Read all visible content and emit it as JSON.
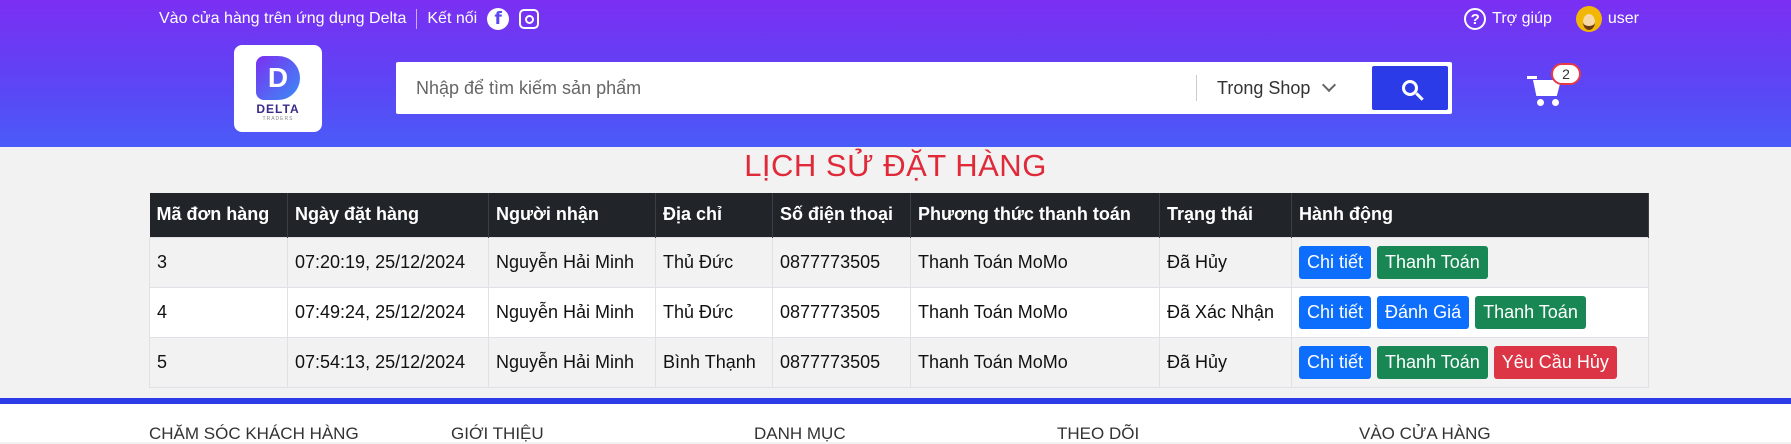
{
  "topbar": {
    "store_app_text": "Vào cửa hàng trên ứng dụng Delta",
    "connect_text": "Kết nối",
    "help_text": "Trợ giúp",
    "user_text": "user"
  },
  "logo": {
    "name": "DELTA",
    "sub": "TRADERS"
  },
  "search": {
    "placeholder": "Nhập để tìm kiếm sản phẩm",
    "scope": "Trong Shop"
  },
  "cart": {
    "count": "2"
  },
  "page_title": "LỊCH SỬ ĐẶT HÀNG",
  "table": {
    "headers": [
      "Mã đơn hàng",
      "Ngày đặt hàng",
      "Người nhận",
      "Địa chỉ",
      "Số điện thoại",
      "Phương thức thanh toán",
      "Trạng thái",
      "Hành động"
    ],
    "rows": [
      {
        "id": "3",
        "date": "07:20:19, 25/12/2024",
        "recipient": "Nguyễn Hải Minh",
        "address": "Thủ Đức",
        "phone": "0877773505",
        "payment": "Thanh Toán MoMo",
        "status": "Đã Hủy",
        "actions": [
          "Chi tiết",
          "Thanh Toán"
        ]
      },
      {
        "id": "4",
        "date": "07:49:24, 25/12/2024",
        "recipient": "Nguyễn Hải Minh",
        "address": "Thủ Đức",
        "phone": "0877773505",
        "payment": "Thanh Toán MoMo",
        "status": "Đã Xác Nhận",
        "actions": [
          "Chi tiết",
          "Đánh Giá",
          "Thanh Toán"
        ]
      },
      {
        "id": "5",
        "date": "07:54:13, 25/12/2024",
        "recipient": "Nguyễn Hải Minh",
        "address": "Bình Thạnh",
        "phone": "0877773505",
        "payment": "Thanh Toán MoMo",
        "status": "Đã Hủy",
        "actions": [
          "Chi tiết",
          "Thanh Toán",
          "Yêu Cầu Hủy"
        ]
      }
    ]
  },
  "footer": {
    "columns": [
      "CHĂM SÓC KHÁCH HÀNG",
      "GIỚI THIỆU",
      "DANH MỤC",
      "THEO DÕI",
      "VÀO CỬA HÀNG"
    ]
  },
  "colors": {
    "header_gradient_top": "#7b2ff2",
    "header_gradient_bottom": "#4a5cf8",
    "title_red": "#e02a3a",
    "btn_blue": "#0d6efd",
    "btn_green": "#198754",
    "btn_red": "#dc3545"
  }
}
